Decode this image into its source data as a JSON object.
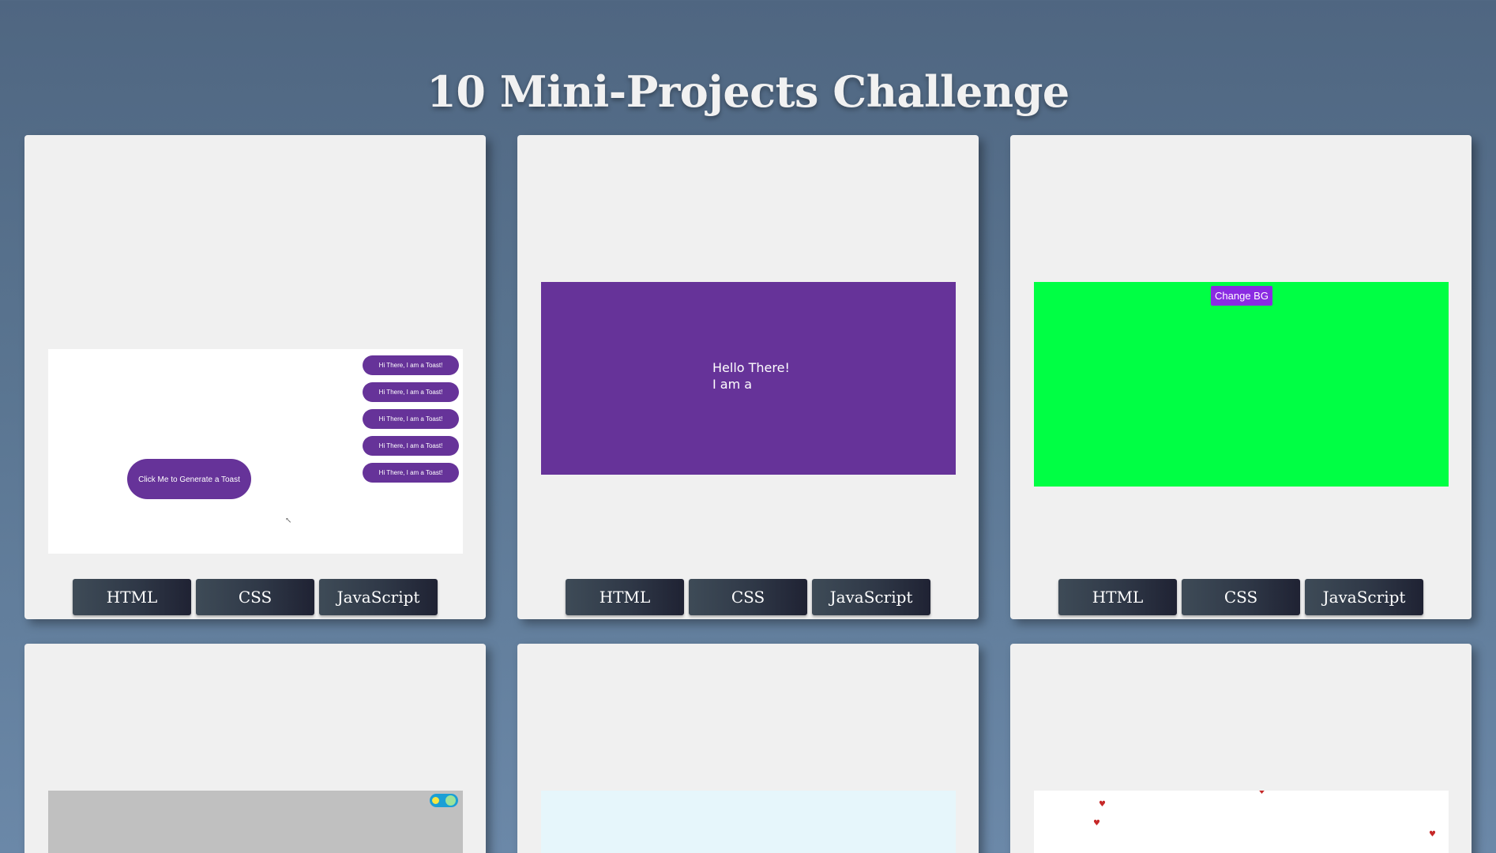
{
  "page": {
    "title": "10 Mini-Projects Challenge"
  },
  "buttons": {
    "html": "HTML",
    "css": "CSS",
    "javascript": "JavaScript"
  },
  "cards": [
    {
      "toasts": [
        "Hi There, I am a Toast!",
        "Hi There, I am a Toast!",
        "Hi There, I am a Toast!",
        "Hi There, I am a Toast!",
        "Hi There, I am a Toast!"
      ],
      "main_button": "Click Me to Generate a Toast"
    },
    {
      "line1": "Hello There!",
      "line2": "I am a"
    },
    {
      "button": "Change BG"
    }
  ],
  "colors": {
    "purple": "#663399",
    "green": "#00ff44",
    "violet": "#8a2be2",
    "card_bg": "#f0f0f0"
  }
}
